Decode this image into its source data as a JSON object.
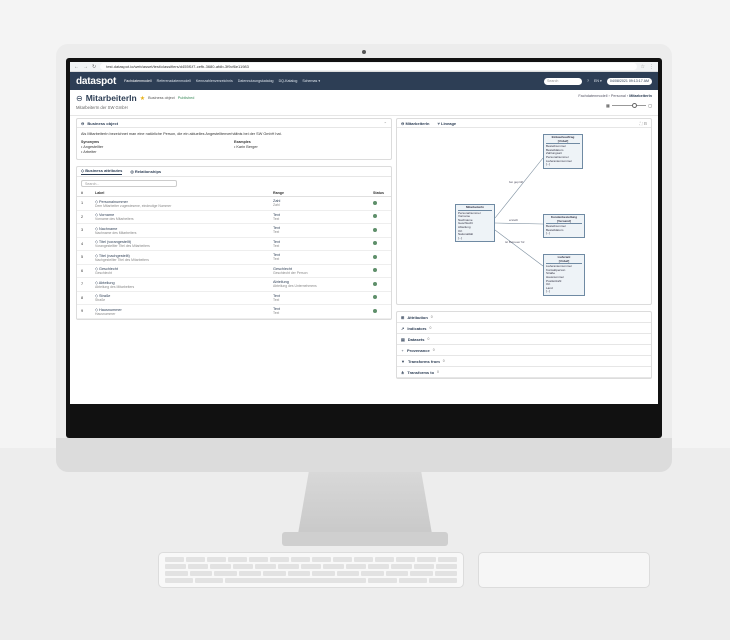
{
  "browser": {
    "url": "test.dataspot.io/web/asset/test/classifiers/d455f1f7-cefb-3680-afdb-3f9cf6e11983"
  },
  "app": {
    "logo": "dataspot",
    "nav": [
      "Fachdatenmodell",
      "Referenzdatenmodell",
      "Kennzahlenverzeichnis",
      "Datennutzungskatalog",
      "DQ-Katalog",
      "Schemas ▾"
    ],
    "search_placeholder": "Search",
    "lang": "EN ▾",
    "datetime": "04/08/2021 09:13:17 AM"
  },
  "header": {
    "title": "MitarbeiterIn",
    "type_label": "Business object",
    "status_label": "Published",
    "subtitle": "MitarbeiterIn der SW GmbH",
    "breadcrumb": [
      "Fachdatenmodell",
      "Personal",
      "MitarbeiterIn"
    ]
  },
  "business_object": {
    "heading": "Business object",
    "description": "Als MitarbeiterIn bezeichnet man eine natürliche Person, die ein aktuelles Angestelltenverhältnis bei der SW GmbH hat.",
    "synonyms_label": "Synonyms",
    "synonyms": [
      "Angestellter",
      "Arbeiter"
    ],
    "examples_label": "Examples",
    "examples": [
      "Karin Berger"
    ]
  },
  "attributes": {
    "tab_attributes": "Business attributes",
    "tab_relationships": "Relationships",
    "filter_placeholder": "Search...",
    "col_num": "#",
    "col_label": "Label",
    "col_range": "Range",
    "col_status": "Status",
    "rows": [
      {
        "num": "1",
        "label": "Personalnummer",
        "desc": "Dem Mitarbeiter zugewiesene, eindeutige Nummer",
        "range": "Zahl",
        "range_sub": "Zahl"
      },
      {
        "num": "2",
        "label": "Vorname",
        "desc": "Vorname des Mitarbeiters",
        "range": "Text",
        "range_sub": "Text"
      },
      {
        "num": "3",
        "label": "Nachname",
        "desc": "Nachname des Mitarbeiters",
        "range": "Text",
        "range_sub": "Text"
      },
      {
        "num": "4",
        "label": "Titel (vorangestellt)",
        "desc": "Vorangestellter Titel des Mitarbeiters",
        "range": "Text",
        "range_sub": "Text"
      },
      {
        "num": "5",
        "label": "Titel (nachgestellt)",
        "desc": "Nachgestellter Titel des Mitarbeiters",
        "range": "Text",
        "range_sub": "Text"
      },
      {
        "num": "6",
        "label": "Geschlecht",
        "desc": "Geschlecht",
        "range": "Geschlecht",
        "range_sub": "Geschlecht der Person"
      },
      {
        "num": "7",
        "label": "Abteilung",
        "desc": "Abteilung des Mitarbeiters",
        "range": "Abteilung",
        "range_sub": "Abteilung des Unternehmens"
      },
      {
        "num": "8",
        "label": "Straße",
        "desc": "Straße",
        "range": "Text",
        "range_sub": "Text"
      },
      {
        "num": "9",
        "label": "Hausnummer",
        "desc": "Hausnummer",
        "range": "Text",
        "range_sub": "Text"
      }
    ]
  },
  "lineage": {
    "tab_object": "MitarbeiterIn",
    "tab_lineage": "Lineage",
    "nodes": {
      "center": {
        "title": "MitarbeiterIn",
        "fields": [
          "Personalnummer",
          "Vorname",
          "Nachname",
          "Geschlecht",
          "Abteilung",
          "Ort",
          "Nationalität",
          "[...]"
        ]
      },
      "top": {
        "title": "Einkaufsauftrag",
        "sub": "[Unbef]",
        "fields": [
          "Bestellnummer",
          "Bestelldatum",
          "Zahlungsart",
          "Personalnummer",
          "Lieferantennummer",
          "[...]"
        ]
      },
      "middle": {
        "title": "Kundenbestellung",
        "sub": "[Versand]",
        "fields": [
          "Bestellnummer",
          "Bestelldatum",
          "[...]"
        ]
      },
      "bottom": {
        "title": "Lieferant",
        "sub": "[Unbef]",
        "fields": [
          "Lieferantennummer",
          "Kontaktperson",
          "Straße",
          "Hausnummer",
          "Postleitzahl",
          "Ort",
          "Land",
          "[...]"
        ]
      }
    },
    "edge_labels": [
      "bei geprüft",
      "erstellt",
      "ist Betreuer für"
    ]
  },
  "panels": [
    {
      "label": "Attribution",
      "count": "0"
    },
    {
      "label": "Indicators",
      "count": "0"
    },
    {
      "label": "Datasets",
      "count": "0"
    },
    {
      "label": "Provenance",
      "count": "0"
    },
    {
      "label": "Transforms from",
      "count": "0"
    },
    {
      "label": "Transforms to",
      "count": "0"
    }
  ]
}
